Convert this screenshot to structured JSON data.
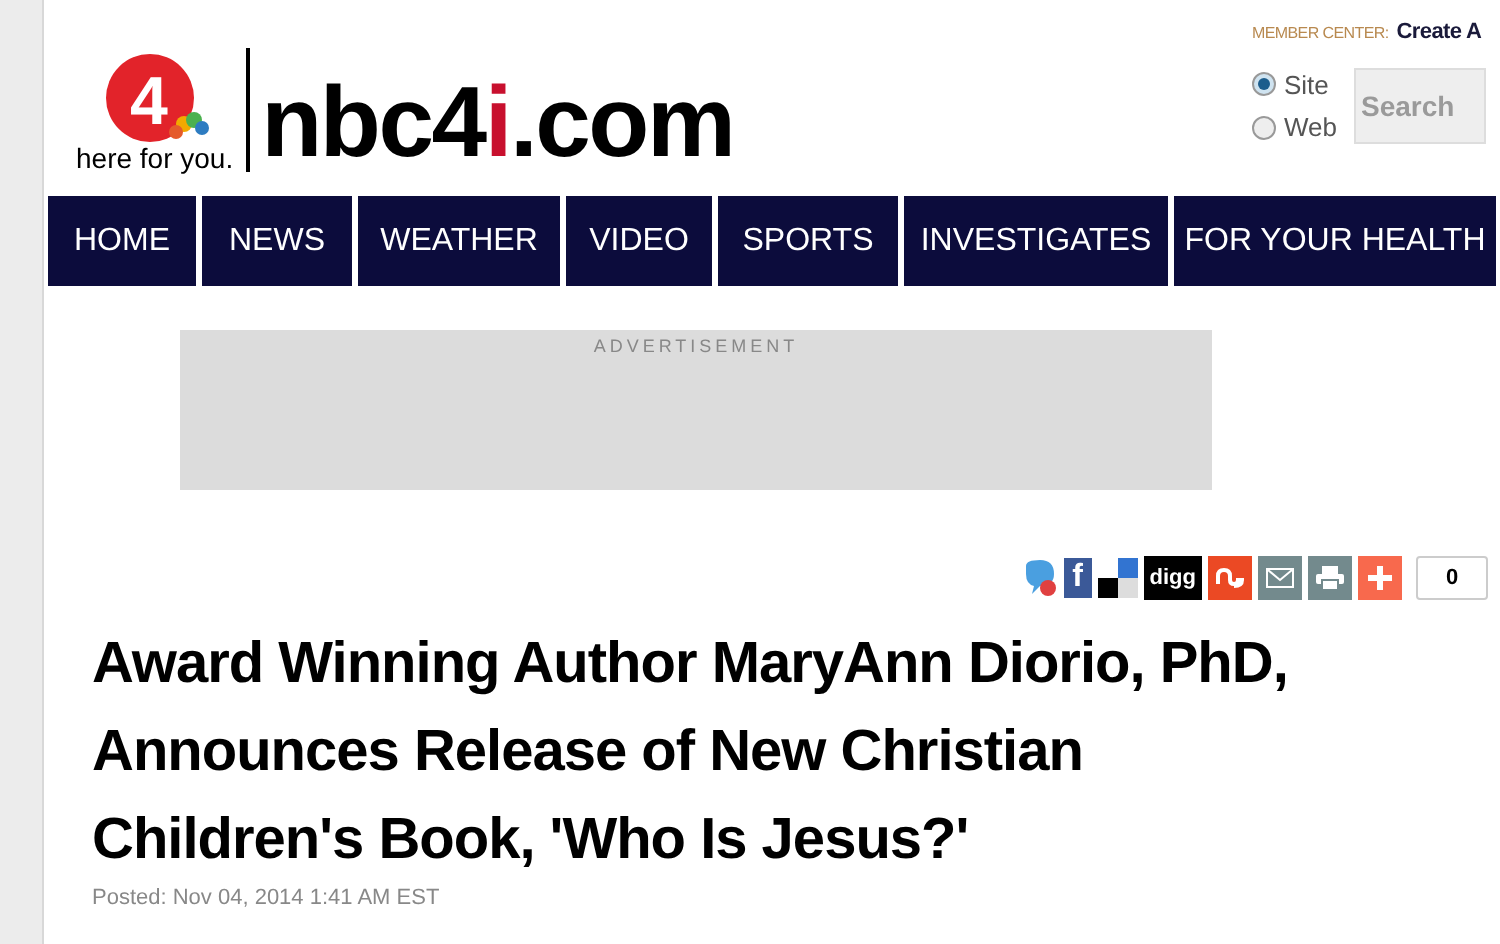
{
  "header": {
    "logo_numeral": "4",
    "logo_tagline": "here for you.",
    "site_name_parts": [
      "nbc4",
      "i",
      ".com"
    ],
    "member_center": {
      "label": "MEMBER CENTER:",
      "link": "Create A"
    },
    "search_scope": [
      {
        "label": "Site",
        "selected": true
      },
      {
        "label": "Web",
        "selected": false
      }
    ],
    "search": {
      "placeholder": "Search"
    }
  },
  "nav": [
    {
      "label": "HOME"
    },
    {
      "label": "NEWS"
    },
    {
      "label": "WEATHER"
    },
    {
      "label": "VIDEO"
    },
    {
      "label": "SPORTS"
    },
    {
      "label": "INVESTIGATES"
    },
    {
      "label": "FOR YOUR HEALTH"
    }
  ],
  "advertisement": {
    "label": "ADVERTISEMENT"
  },
  "share": {
    "buttons": [
      {
        "kind": "chat"
      },
      {
        "kind": "facebook",
        "text": "f"
      },
      {
        "kind": "delicious"
      },
      {
        "kind": "digg",
        "text": "digg"
      },
      {
        "kind": "stumble"
      },
      {
        "kind": "email"
      },
      {
        "kind": "print"
      },
      {
        "kind": "plus"
      }
    ],
    "count": "0"
  },
  "article": {
    "title_lines": [
      "Award Winning Author MaryAnn Diorio, PhD,",
      "Announces Release of New Christian",
      "Children's Book, 'Who Is Jesus?'"
    ],
    "posted": "Posted: Nov 04, 2014 1:41 AM EST"
  }
}
